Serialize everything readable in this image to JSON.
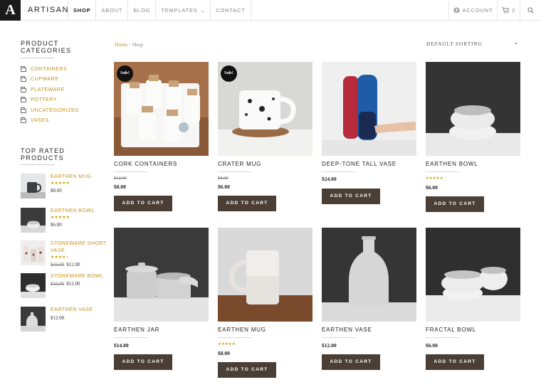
{
  "header": {
    "logo": "A",
    "brand": "ARTISAN",
    "nav": [
      {
        "label": "SHOP",
        "active": true
      },
      {
        "label": "ABOUT"
      },
      {
        "label": "BLOG"
      },
      {
        "label": "TEMPLATES",
        "dropdown": true
      },
      {
        "label": "CONTACT"
      }
    ],
    "account_label": "ACCOUNT",
    "account_icon": "user-icon",
    "cart_count": "2",
    "cart_icon": "cart-icon",
    "search_icon": "search-icon"
  },
  "sidebar": {
    "categories_title": "PRODUCT CATEGORIES",
    "categories": [
      "CONTAINERS",
      "CUPWARE",
      "PLATEWARE",
      "POTTERY",
      "UNCATEGORIZED",
      "VASES"
    ],
    "top_rated_title": "TOP RATED PRODUCTS",
    "top_rated": [
      {
        "name": "EARTHEN MUG",
        "rating": 5,
        "price": "$8.00",
        "old_price": ""
      },
      {
        "name": "EARTHEN BOWL",
        "rating": 5,
        "price": "$6.00",
        "old_price": ""
      },
      {
        "name": "STONEWARE SHORT VASE",
        "rating": 4,
        "price": "$12.00",
        "old_price": "$16.00"
      },
      {
        "name": "STONEWARE BOWL",
        "rating": 0,
        "price": "$12.00",
        "old_price": "$16.00"
      },
      {
        "name": "EARTHEN VASE",
        "rating": 0,
        "price": "$12.00",
        "old_price": ""
      }
    ]
  },
  "breadcrumb": {
    "home": "Home",
    "separator": "›",
    "current": "Shop"
  },
  "sorting": {
    "selected": "DEFAULT SORTING"
  },
  "add_to_cart_label": "ADD TO CART",
  "sale_label": "Sale!",
  "products": [
    {
      "name": "CORK CONTAINERS",
      "old_price": "$12.00",
      "price": "$8.00",
      "sale": true,
      "rating": 0
    },
    {
      "name": "CRATER MUG",
      "old_price": "$8.00",
      "price": "$6.00",
      "sale": true,
      "rating": 0
    },
    {
      "name": "DEEP-TONE TALL VASE",
      "old_price": "",
      "price": "$24.00",
      "sale": false,
      "rating": 0
    },
    {
      "name": "EARTHEN BOWL",
      "old_price": "",
      "price": "$6.00",
      "sale": false,
      "rating": 5
    },
    {
      "name": "EARTHEN JAR",
      "old_price": "",
      "price": "$14.00",
      "sale": false,
      "rating": 0
    },
    {
      "name": "EARTHEN MUG",
      "old_price": "",
      "price": "$8.00",
      "sale": false,
      "rating": 5
    },
    {
      "name": "EARTHEN VASE",
      "old_price": "",
      "price": "$12.00",
      "sale": false,
      "rating": 0
    },
    {
      "name": "FRACTAL BOWL",
      "old_price": "",
      "price": "$6.00",
      "sale": false,
      "rating": 0
    }
  ],
  "colors": {
    "accent": "#c3901e",
    "button": "#4a3e35",
    "text": "#222222",
    "star": "#c8a400"
  }
}
